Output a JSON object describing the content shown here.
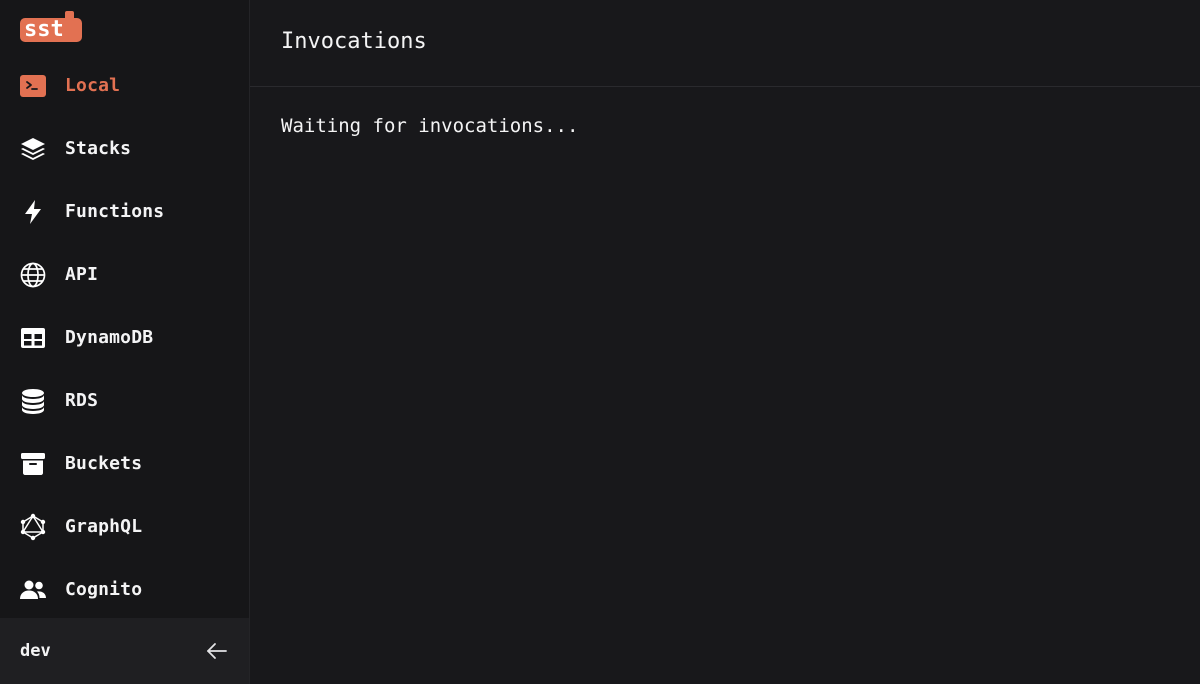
{
  "brand": {
    "logo_text": "sst",
    "accent_color": "#e27152"
  },
  "sidebar": {
    "items": [
      {
        "label": "Local",
        "icon": "terminal-icon",
        "active": true
      },
      {
        "label": "Stacks",
        "icon": "layers-icon",
        "active": false
      },
      {
        "label": "Functions",
        "icon": "lightning-icon",
        "active": false
      },
      {
        "label": "API",
        "icon": "globe-icon",
        "active": false
      },
      {
        "label": "DynamoDB",
        "icon": "table-icon",
        "active": false
      },
      {
        "label": "RDS",
        "icon": "database-icon",
        "active": false
      },
      {
        "label": "Buckets",
        "icon": "archive-icon",
        "active": false
      },
      {
        "label": "GraphQL",
        "icon": "graphql-icon",
        "active": false
      },
      {
        "label": "Cognito",
        "icon": "users-icon",
        "active": false
      }
    ],
    "footer": {
      "stage": "dev",
      "icon": "arrow-left-icon"
    }
  },
  "main": {
    "title": "Invocations",
    "message": "Waiting for invocations..."
  }
}
